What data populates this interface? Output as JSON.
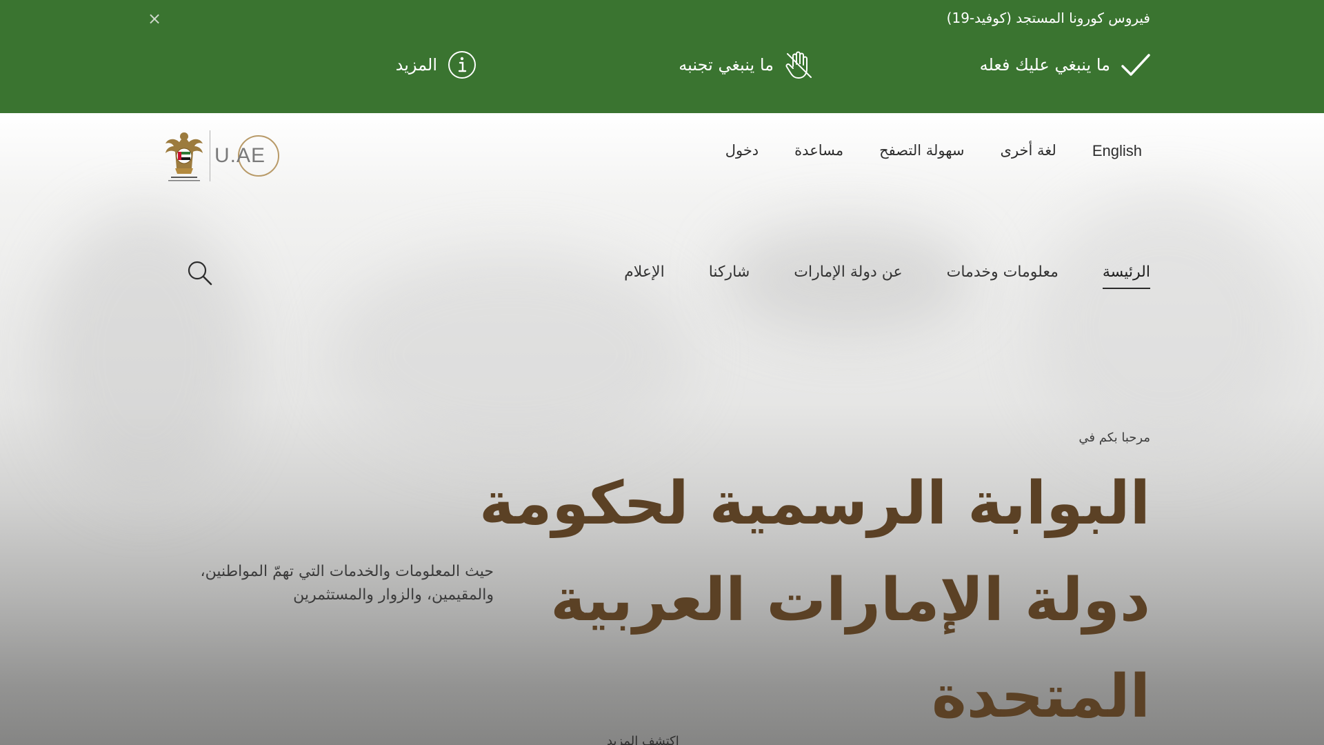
{
  "covid_banner": {
    "title": "فيروس كورونا المستجد (كوفيد-19)",
    "close_label": "×",
    "links": [
      {
        "label": "ما ينبغي عليك فعله",
        "icon": "checkmark-icon"
      },
      {
        "label": "ما ينبغي تجنبه",
        "icon": "no-hand-icon"
      },
      {
        "label": "المزيد",
        "icon": "info-icon"
      }
    ],
    "background_color": "#3a7430"
  },
  "utility_nav": {
    "items": [
      "English",
      "لغة أخرى",
      "سهولة التصفح",
      "مساعدة",
      "دخول"
    ]
  },
  "logo": {
    "text": "U.AE",
    "emblem_caption": "United Arab Emirates"
  },
  "main_nav": {
    "items": [
      "الرئيسة",
      "معلومات وخدمات",
      "عن دولة الإمارات",
      "شاركنا",
      "الإعلام"
    ],
    "active_index": 0
  },
  "hero": {
    "welcome": "مرحبا بكم في",
    "headline": "البوابة الرسمية لحكومة دولة الإمارات العربية المتحدة",
    "subtext": "حيث المعلومات والخدمات التي تهمّ المواطنين، والمقيمين، والزوار والمستثمرين",
    "discover": "اكتشف المزيد",
    "headline_color": "#5b4125"
  }
}
